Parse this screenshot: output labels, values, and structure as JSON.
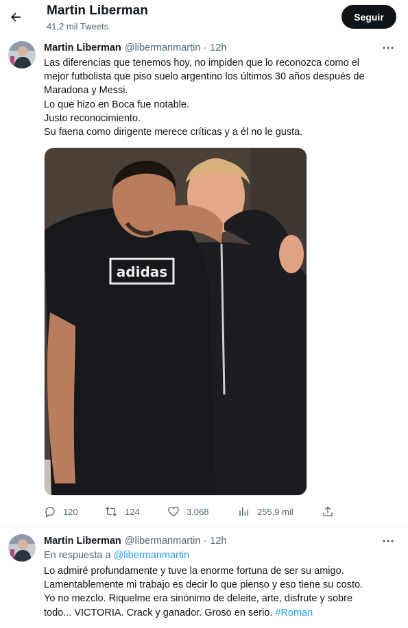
{
  "header": {
    "back_icon": "arrow-left-icon",
    "name": "Martin Liberman",
    "tweets_count": "41,2 mil Tweets",
    "follow_label": "Seguir"
  },
  "tweets": [
    {
      "author": "Martin Liberman",
      "handle": "@libermanmartin",
      "separator": "·",
      "time": "12h",
      "text_lines": [
        "Las diferencias que tenemos hoy, no impiden que lo reconozca como el",
        "mejor futbolista que piso suelo argentino los últimos 30 años después de",
        "Maradona y Messi.",
        "Lo que hizo en Boca fue notable.",
        "Justo reconocimiento.",
        "Su faena como dirigente merece críticas y a él no le gusta."
      ],
      "shirt_text": "adidas",
      "actions": {
        "replies": "120",
        "retweets": "124",
        "likes": "3.068",
        "views": "255,9 mil"
      }
    },
    {
      "author": "Martin Liberman",
      "handle": "@libermanmartin",
      "separator": "·",
      "time": "12h",
      "reply_prefix": "En respuesta a",
      "reply_handle": "@libermanmartin",
      "text_lines": [
        "Lo admiré profundamente y tuve la enorme fortuna de ser su amigo.",
        "Lamentablemente mi trabajo es decir lo que pienso y eso tiene su costo.",
        "Yo no mezclo. Riquelme era sinónimo de deleite, arte, disfrute y sobre"
      ],
      "last_line": "todo... VICTORIA. Crack y ganador. Groso en serio.",
      "hashtag": "#Roman"
    }
  ],
  "colors": {
    "text": "#0f1419",
    "secondary": "#536471",
    "link": "#1d9bf0",
    "button": "#0f1419"
  }
}
